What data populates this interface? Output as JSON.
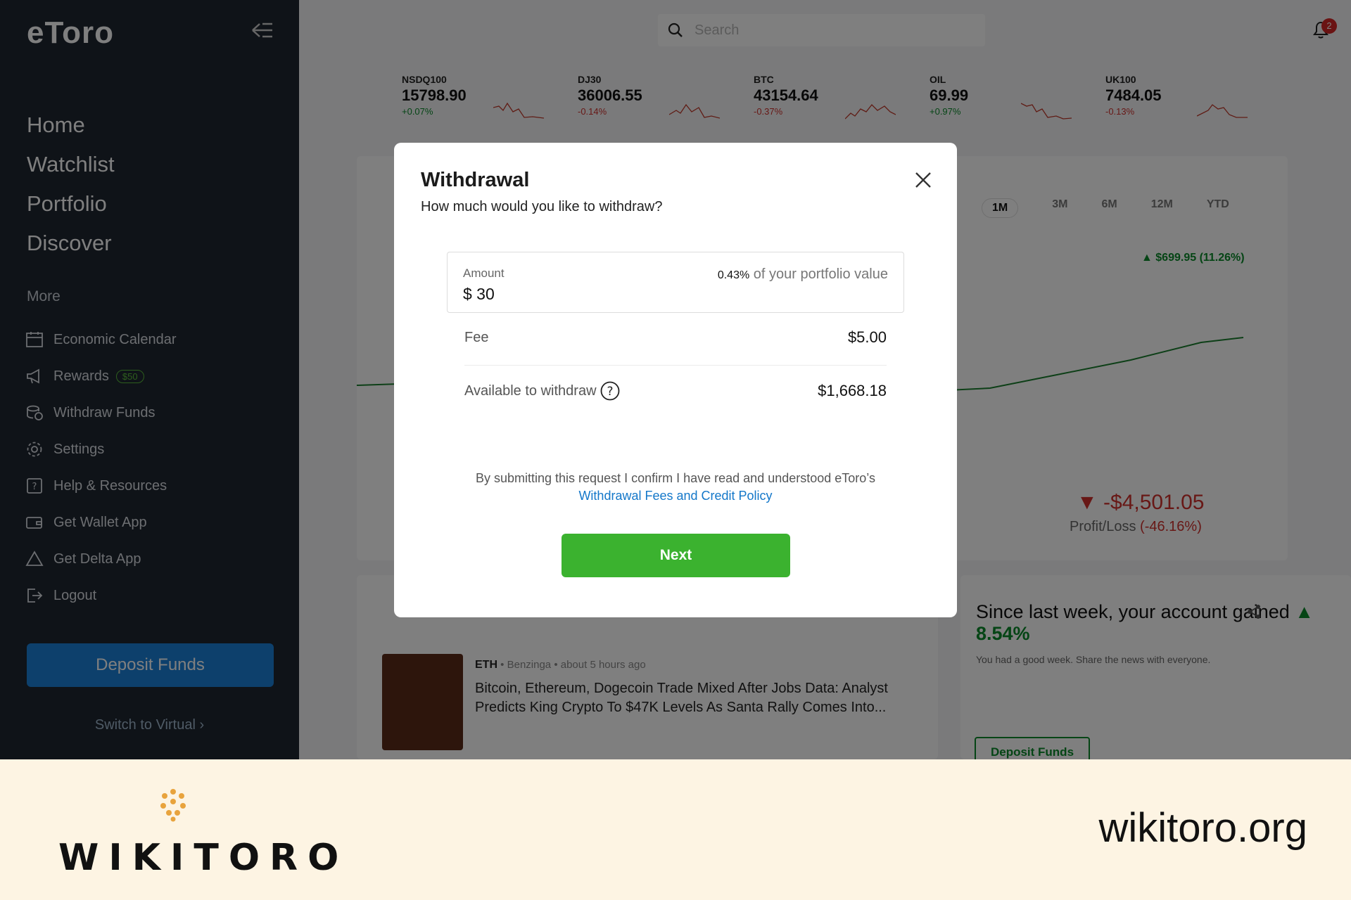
{
  "sidebar": {
    "logo": "eToro",
    "main_nav": [
      "Home",
      "Watchlist",
      "Portfolio",
      "Discover"
    ],
    "more_title": "More",
    "items": [
      {
        "label": "Economic Calendar",
        "icon": "calendar-icon"
      },
      {
        "label": "Rewards",
        "icon": "megaphone-icon",
        "badge": "$50"
      },
      {
        "label": "Withdraw Funds",
        "icon": "coins-icon"
      },
      {
        "label": "Settings",
        "icon": "gear-icon"
      },
      {
        "label": "Help & Resources",
        "icon": "help-icon"
      },
      {
        "label": "Get Wallet App",
        "icon": "wallet-icon"
      },
      {
        "label": "Get Delta App",
        "icon": "delta-icon"
      },
      {
        "label": "Logout",
        "icon": "logout-icon"
      }
    ],
    "deposit_label": "Deposit Funds",
    "switch_label": "Switch to Virtual ›"
  },
  "header": {
    "search_placeholder": "Search",
    "notification_count": "2"
  },
  "tickers": [
    {
      "symbol": "NSDQ100",
      "price": "15798.90",
      "change": "+0.07%",
      "direction": "up"
    },
    {
      "symbol": "DJ30",
      "price": "36006.55",
      "change": "-0.14%",
      "direction": "down"
    },
    {
      "symbol": "BTC",
      "price": "43154.64",
      "change": "-0.37%",
      "direction": "down"
    },
    {
      "symbol": "OIL",
      "price": "69.99",
      "change": "+0.97%",
      "direction": "up"
    },
    {
      "symbol": "UK100",
      "price": "7484.05",
      "change": "-0.13%",
      "direction": "down"
    }
  ],
  "background": {
    "range_tabs": [
      "1M",
      "3M",
      "6M",
      "12M",
      "YTD"
    ],
    "active_range": "1M",
    "gain_label": "▲ $699.95 (11.26%)",
    "profit_loss_value": "▼ -$4,501.05",
    "profit_loss_label": "Profit/Loss",
    "profit_loss_pct": "(-46.16%)",
    "since_title": "Since last week, your account gained",
    "since_gain": "▲ 8.54%",
    "since_sub": "You had a good week. Share the news with everyone.",
    "deposit_card_label": "Deposit Funds",
    "news": {
      "symbol": "ETH",
      "source": "Benzinga",
      "time": "about 5 hours ago",
      "title": "Bitcoin, Ethereum, Dogecoin Trade Mixed After Jobs Data: Analyst Predicts King Crypto To $47K Levels As Santa Rally Comes Into..."
    }
  },
  "modal": {
    "title": "Withdrawal",
    "subtitle": "How much would you like to withdraw?",
    "amount_label": "Amount",
    "amount_value": "$ 30",
    "portfolio_pct": "0.43%",
    "portfolio_pct_suffix": "of your portfolio value",
    "fee_label": "Fee",
    "fee_value": "$5.00",
    "available_label": "Available to withdraw",
    "available_value": "$1,668.18",
    "confirm_text": "By submitting this request I confirm I have read and understood eToro’s",
    "policy_link": "Withdrawal Fees and Credit Policy",
    "next_label": "Next"
  },
  "footer": {
    "brand": "WIKITORO",
    "url": "wikitoro.org"
  },
  "colors": {
    "sidebar_bg": "#1f2631",
    "next_green": "#3bb22f",
    "link_blue": "#1377c9",
    "negative_red": "#d0312d",
    "positive_green": "#0a8a2a",
    "footer_bg": "#fdf4e3"
  }
}
